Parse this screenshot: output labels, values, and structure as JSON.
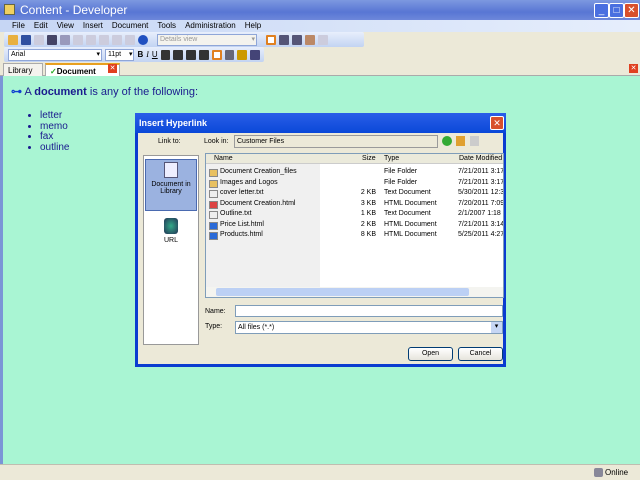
{
  "window": {
    "title": "Content - Developer",
    "minimize": "_",
    "maximize": "□",
    "close": "✕"
  },
  "menu": [
    "File",
    "Edit",
    "View",
    "Insert",
    "Document",
    "Tools",
    "Administration",
    "Help"
  ],
  "toolbar": {
    "view_select": "Details view"
  },
  "format": {
    "font": "Arial",
    "size": "11pt",
    "bold": "B",
    "italic": "I",
    "underline": "U"
  },
  "tabs": [
    {
      "label": "Library"
    },
    {
      "label": "Document"
    }
  ],
  "document": {
    "prefix": "A ",
    "term": "document",
    "suffix": " is any of the following:",
    "items": [
      "letter",
      "memo",
      "fax",
      "outline"
    ]
  },
  "status": {
    "text": "Online"
  },
  "dialog": {
    "title": "Insert Hyperlink",
    "link_to": "Link to:",
    "look_in_label": "Look in:",
    "look_in": "Customer Files",
    "places": [
      {
        "label": "Document in Library",
        "selected": true
      },
      {
        "label": "URL",
        "selected": false
      }
    ],
    "columns": [
      "Name",
      "Size",
      "Type",
      "Date Modified"
    ],
    "files": [
      {
        "name": "Document Creation_files",
        "size": "",
        "type": "File Folder",
        "date": "7/21/2011 3:17",
        "icon": "folder"
      },
      {
        "name": "Images and Logos",
        "size": "",
        "type": "File Folder",
        "date": "7/21/2011 3:17",
        "icon": "folder"
      },
      {
        "name": "cover letter.txt",
        "size": "2 KB",
        "type": "Text Document",
        "date": "5/30/2011 12:3",
        "icon": "text"
      },
      {
        "name": "Document Creation.html",
        "size": "3 KB",
        "type": "HTML Document",
        "date": "7/20/2011 7:09",
        "icon": "html-doc"
      },
      {
        "name": "Outline.txt",
        "size": "1 KB",
        "type": "Text Document",
        "date": "2/1/2007 1:18",
        "icon": "text"
      },
      {
        "name": "Price List.html",
        "size": "2 KB",
        "type": "HTML Document",
        "date": "7/21/2011 3:14",
        "icon": "ie"
      },
      {
        "name": "Products.html",
        "size": "8 KB",
        "type": "HTML Document",
        "date": "5/25/2011 4:27",
        "icon": "ie"
      }
    ],
    "name_label": "Name:",
    "name_value": "",
    "type_label": "Type:",
    "type_value": "All files (*.*)",
    "open": "Open",
    "cancel": "Cancel"
  }
}
